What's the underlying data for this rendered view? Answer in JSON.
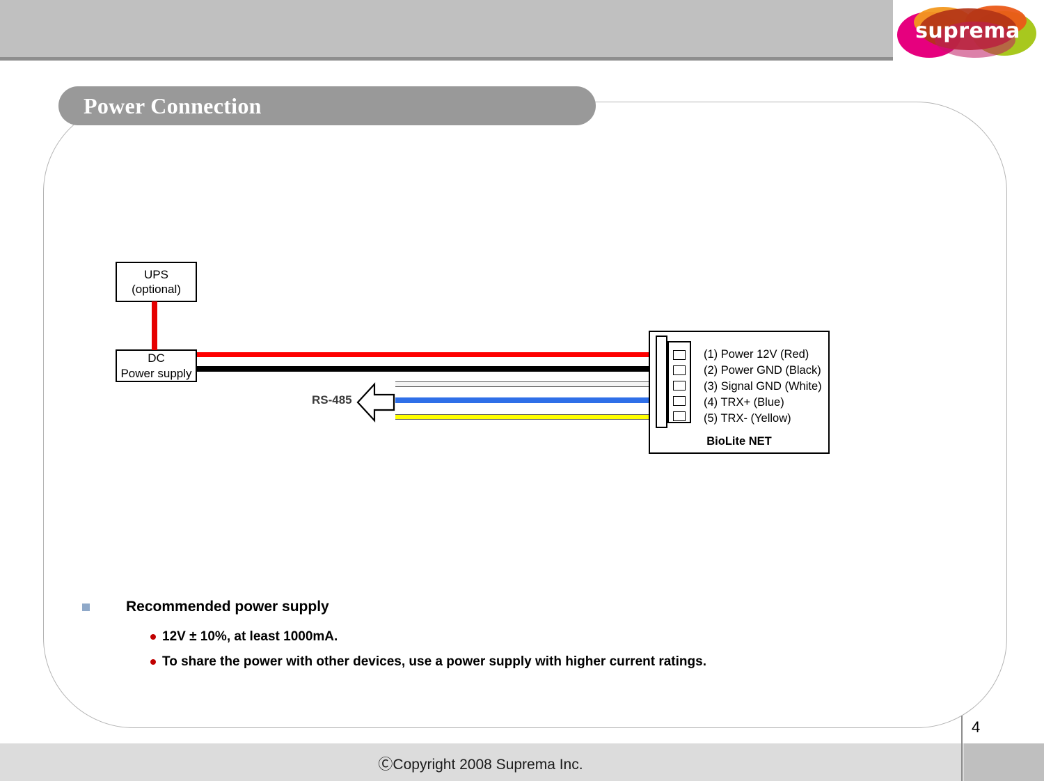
{
  "header": {
    "logo_text": "suprema",
    "logo_colors": {
      "magenta": "#e6007e",
      "orange": "#f08a1c",
      "maroon": "#a8321e",
      "green": "#a8c81e",
      "dark_orange": "#e8601c"
    }
  },
  "slide": {
    "title": "Power Connection",
    "title_bar_color": "#999999",
    "frame_border_color": "#b4b4b4"
  },
  "diagram": {
    "boxes": [
      {
        "id": "ups",
        "line1": "UPS",
        "line2": "(optional)"
      },
      {
        "id": "dc",
        "line1": "DC",
        "line2": "Power supply"
      }
    ],
    "bus_label": "RS-485",
    "device_name": "BioLite NET",
    "wires": [
      {
        "name": "power-12v",
        "color": "#fe0000",
        "label_color": "Red"
      },
      {
        "name": "power-gnd",
        "color": "#000000",
        "label_color": "Black"
      },
      {
        "name": "signal-gnd",
        "color": "#f4f4f4",
        "label_color": "White"
      },
      {
        "name": "trx-plus",
        "color": "#2f6fe8",
        "label_color": "Blue"
      },
      {
        "name": "trx-minus",
        "color": "#ffff00",
        "label_color": "Yellow"
      }
    ],
    "pin_labels": [
      "(1) Power 12V (Red)",
      "(2) Power GND (Black)",
      "(3) Signal GND (White)",
      "(4) TRX+ (Blue)",
      "(5) TRX- (Yellow)"
    ]
  },
  "bullets": {
    "heading": "Recommended power supply",
    "marker_color": "#8fa9c9",
    "sub_marker_color": "#c00000",
    "items": [
      "12V ± 10%, at least 1000mA.",
      "To share the power with other devices, use a power supply with higher current ratings."
    ]
  },
  "footer": {
    "copyright": "ⒸCopyright 2008 Suprema Inc.",
    "page_number": "4"
  }
}
